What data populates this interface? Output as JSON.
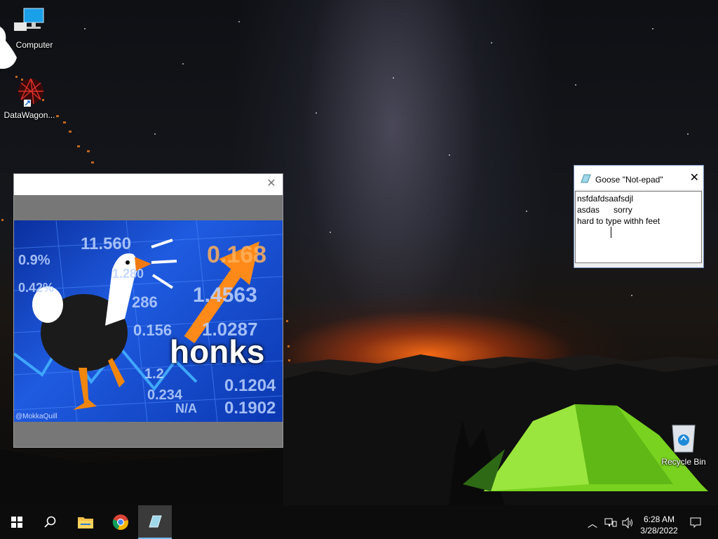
{
  "desktop": {
    "icons": [
      {
        "label": "Computer"
      },
      {
        "label": "DataWagon..."
      },
      {
        "label": "Recycle Bin"
      }
    ]
  },
  "meme_window": {
    "image_text": "honks",
    "watermark": "@MokkaQuill",
    "ticker_numbers": [
      "11.560",
      "0.9%",
      "0.42%",
      "286",
      "1.4563",
      "0.156",
      "0.1204",
      "0.1902",
      "1.0287",
      "N/A",
      "0.234",
      "1.2",
      "0.168",
      "1.280"
    ]
  },
  "notepad": {
    "title": "Goose \"Not-epad\"",
    "lines": [
      "nsfdafdsaafsdjl",
      "asdas      sorry",
      "hard to type withh feet"
    ]
  },
  "taskbar": {
    "time": "6:28 AM",
    "date": "3/28/2022",
    "apps": [
      "start-icon",
      "search-icon",
      "file-explorer-icon",
      "chrome-icon",
      "goose-notepad-icon"
    ]
  },
  "colors": {
    "taskbar_bg": "#0c0c0c",
    "active_accent": "#76b9ed",
    "tent_green": "#7bd72a"
  }
}
